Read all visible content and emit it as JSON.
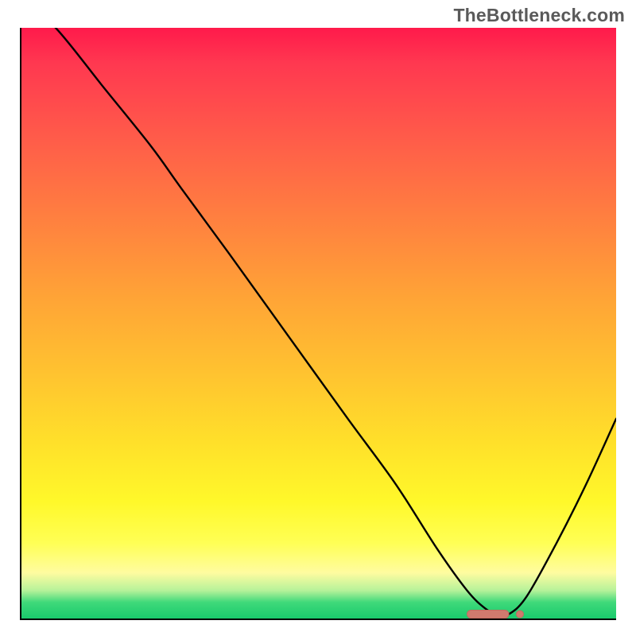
{
  "watermark": "TheBottleneck.com",
  "colors": {
    "curve": "#000000",
    "marker_fill": "#d07a6e",
    "marker_stroke": "#c46a5e"
  },
  "chart_data": {
    "type": "line",
    "title": "",
    "xlabel": "",
    "ylabel": "",
    "xlim": [
      0,
      100
    ],
    "ylim": [
      0,
      100
    ],
    "grid": false,
    "series": [
      {
        "name": "bottleneck_curve",
        "x": [
          0,
          6,
          14,
          22,
          27,
          35,
          45,
          55,
          63,
          70,
          75,
          78,
          80,
          82,
          85,
          90,
          95,
          100
        ],
        "values": [
          105,
          100,
          90,
          80,
          73,
          62,
          48,
          34,
          23,
          12,
          5,
          2,
          1,
          1,
          4,
          13,
          23,
          34
        ]
      }
    ],
    "annotations": [
      {
        "name": "optimal_flat_region",
        "x_start": 75,
        "x_end": 82,
        "y": 1
      }
    ]
  }
}
